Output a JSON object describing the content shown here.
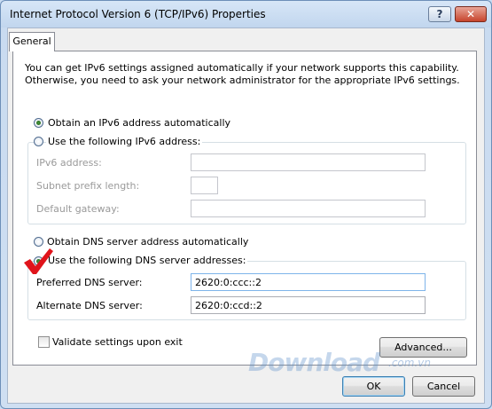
{
  "window": {
    "title": "Internet Protocol Version 6 (TCP/IPv6) Properties",
    "help_glyph": "?",
    "close_glyph": "✕"
  },
  "tabs": [
    {
      "label": "General"
    }
  ],
  "intro_text": "You can get IPv6 settings assigned automatically if your network supports this capability. Otherwise, you need to ask your network administrator for the appropriate IPv6 settings.",
  "ip": {
    "auto_label": "Obtain an IPv6 address automatically",
    "auto_selected": true,
    "manual_label": "Use the following IPv6 address:",
    "address_label": "IPv6 address:",
    "address_value": "",
    "prefix_label": "Subnet prefix length:",
    "prefix_value": "",
    "gateway_label": "Default gateway:",
    "gateway_value": ""
  },
  "dns": {
    "auto_label": "Obtain DNS server address automatically",
    "manual_label": "Use the following DNS server addresses:",
    "manual_selected": true,
    "preferred_label": "Preferred DNS server:",
    "preferred_value": "2620:0:ccc::2",
    "alternate_label": "Alternate DNS server:",
    "alternate_value": "2620:0:ccd::2"
  },
  "validate": {
    "label": "Validate settings upon exit",
    "checked": false
  },
  "buttons": {
    "advanced": "Advanced...",
    "ok": "OK",
    "cancel": "Cancel"
  },
  "watermark": {
    "text": "Download",
    "suffix": ".com.vn"
  }
}
